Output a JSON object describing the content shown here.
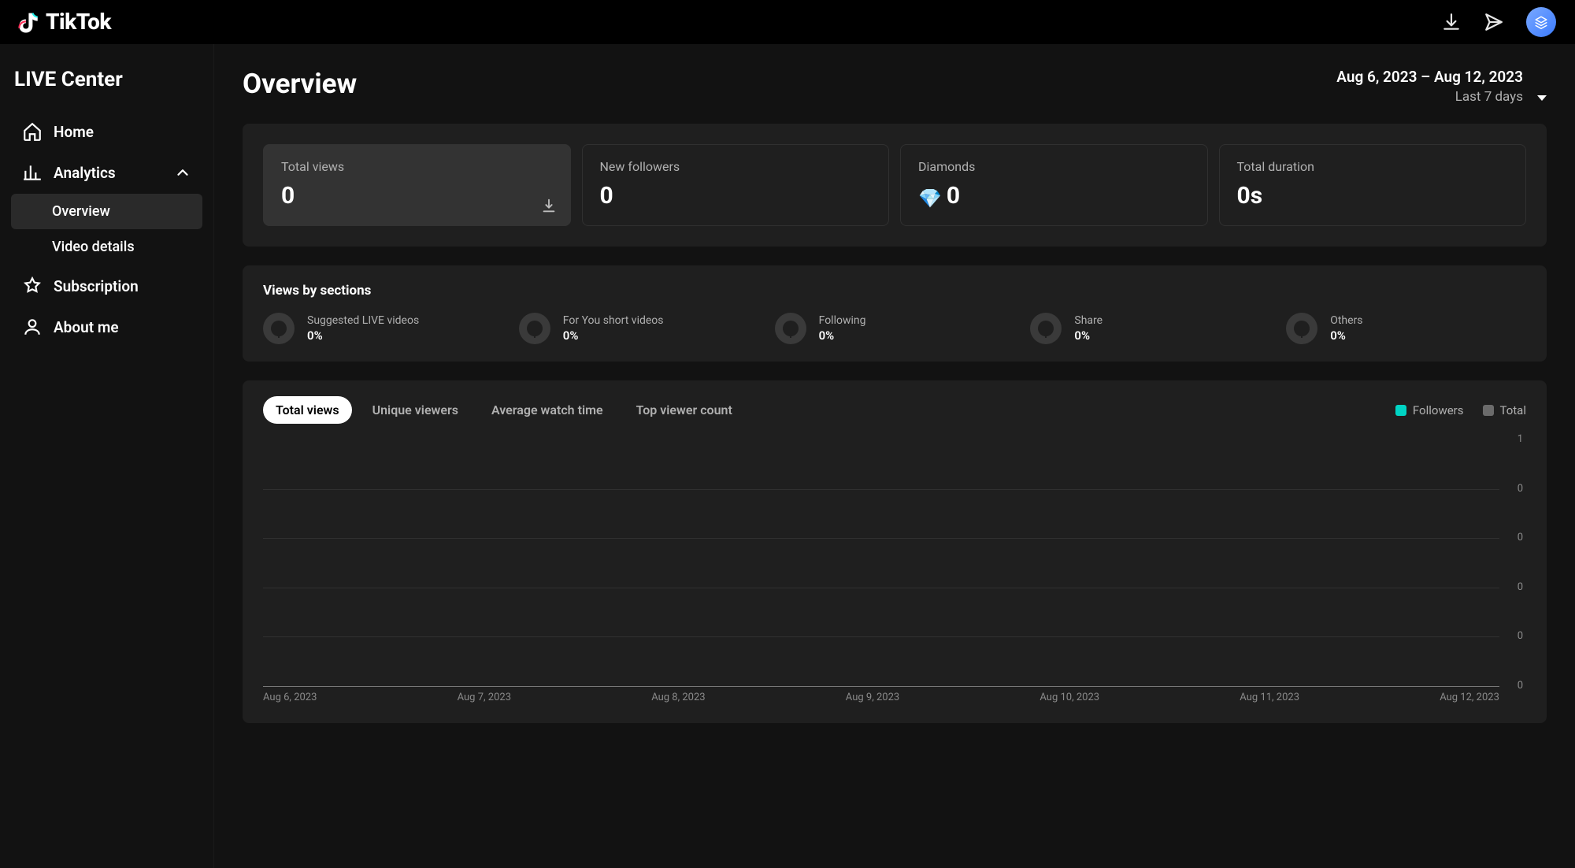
{
  "brand": {
    "name": "TikTok"
  },
  "sidebar": {
    "title": "LIVE Center",
    "items": [
      {
        "id": "home",
        "label": "Home"
      },
      {
        "id": "analytics",
        "label": "Analytics",
        "expanded": true,
        "children": [
          {
            "id": "overview",
            "label": "Overview",
            "active": true
          },
          {
            "id": "video-details",
            "label": "Video details"
          }
        ]
      },
      {
        "id": "subscription",
        "label": "Subscription"
      },
      {
        "id": "about-me",
        "label": "About me"
      }
    ]
  },
  "page": {
    "title": "Overview",
    "date_range": "Aug 6, 2023 – Aug 12, 2023",
    "date_sub": "Last 7 days"
  },
  "stat_cards": [
    {
      "id": "total-views",
      "label": "Total views",
      "value": "0",
      "selected": true,
      "downloadable": true
    },
    {
      "id": "new-followers",
      "label": "New followers",
      "value": "0"
    },
    {
      "id": "diamonds",
      "label": "Diamonds",
      "value": "0",
      "icon": "💎"
    },
    {
      "id": "total-duration",
      "label": "Total duration",
      "value": "0s"
    }
  ],
  "views_by_sections": {
    "title": "Views by sections",
    "items": [
      {
        "label": "Suggested LIVE videos",
        "value": "0%"
      },
      {
        "label": "For You short videos",
        "value": "0%"
      },
      {
        "label": "Following",
        "value": "0%"
      },
      {
        "label": "Share",
        "value": "0%"
      },
      {
        "label": "Others",
        "value": "0%"
      }
    ]
  },
  "chart_tabs": [
    {
      "id": "total-views",
      "label": "Total views",
      "active": true
    },
    {
      "id": "unique-viewers",
      "label": "Unique viewers",
      "active": false
    },
    {
      "id": "average-watch-time",
      "label": "Average watch time",
      "active": false
    },
    {
      "id": "top-viewer-count",
      "label": "Top viewer count",
      "active": false
    }
  ],
  "legend": [
    {
      "id": "followers",
      "label": "Followers",
      "color": "#00d4c4"
    },
    {
      "id": "total",
      "label": "Total",
      "color": "#6b6b6b"
    }
  ],
  "chart_data": {
    "type": "line",
    "title": "Total views",
    "xlabel": "",
    "ylabel": "",
    "categories": [
      "Aug 6, 2023",
      "Aug 7, 2023",
      "Aug 8, 2023",
      "Aug 9, 2023",
      "Aug 10, 2023",
      "Aug 11, 2023",
      "Aug 12, 2023"
    ],
    "y_ticks": [
      1,
      0,
      0,
      0,
      0,
      0
    ],
    "ylim": [
      0,
      1
    ],
    "series": [
      {
        "name": "Followers",
        "values": [
          0,
          0,
          0,
          0,
          0,
          0,
          0
        ]
      },
      {
        "name": "Total",
        "values": [
          0,
          0,
          0,
          0,
          0,
          0,
          0
        ]
      }
    ]
  }
}
